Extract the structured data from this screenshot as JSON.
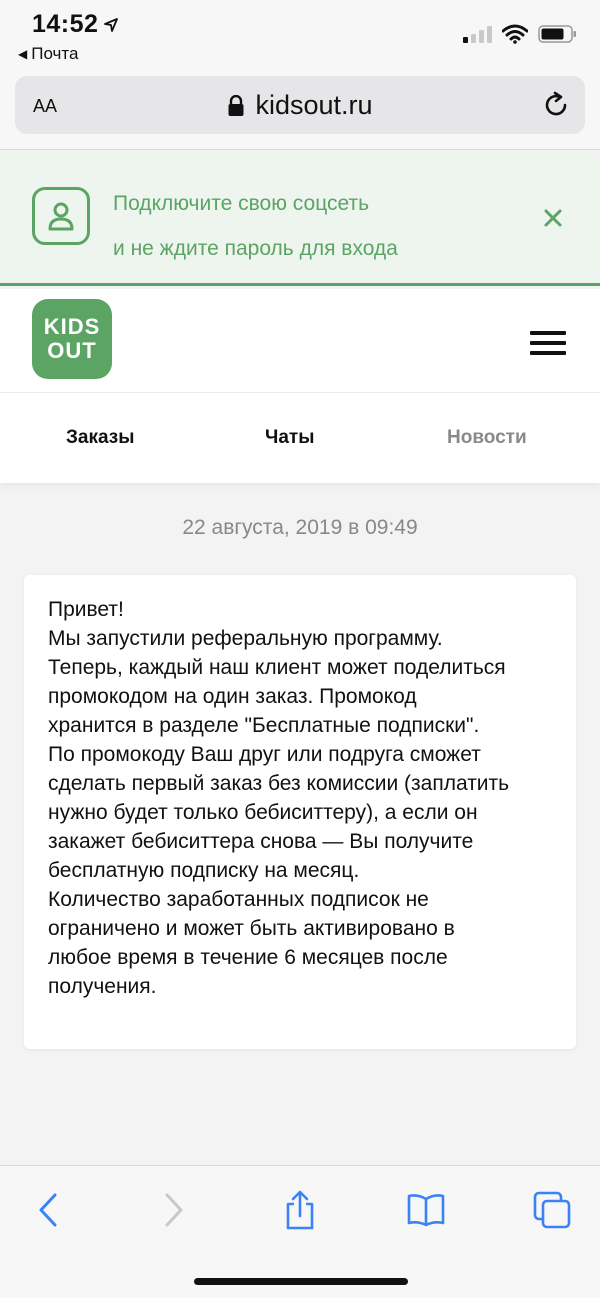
{
  "status_bar": {
    "time": "14:52",
    "back_app": "Почта"
  },
  "browser": {
    "text_size_button": "AA",
    "url": "kidsout.ru"
  },
  "banner": {
    "line1": "Подключите свою соцсеть",
    "line2": "и не ждите пароль для входа",
    "accent_color": "#5ba463"
  },
  "header": {
    "logo_line1": "KIDS",
    "logo_line2": "OUT"
  },
  "tabs": [
    {
      "label": "Заказы",
      "active": true
    },
    {
      "label": "Чаты",
      "active": true
    },
    {
      "label": "Новости",
      "active": false
    }
  ],
  "message": {
    "date": "22 августа, 2019 в 09:49",
    "lines": [
      "Привет!",
      "Мы запустили реферальную программу.",
      "Теперь, каждый наш клиент может поделиться",
      "промокодом на один заказ. Промокод",
      "хранится в разделе \"Бесплатные подписки\".",
      "По промокоду Ваш друг или подруга сможет",
      "сделать первый заказ без комиссии (заплатить",
      "нужно будет только бебиситтеру), а если он",
      "закажет бебиситтера снова — Вы получите",
      "бесплатную подписку на месяц.",
      "Количество заработанных подписок не",
      "ограничено и может быть активировано в",
      "любое время в течение 6 месяцев после",
      "получения."
    ]
  },
  "toolbar": {
    "icons": [
      "back-icon",
      "forward-icon",
      "share-icon",
      "bookmarks-icon",
      "tabs-icon"
    ],
    "tint_color": "#3b82f6"
  }
}
